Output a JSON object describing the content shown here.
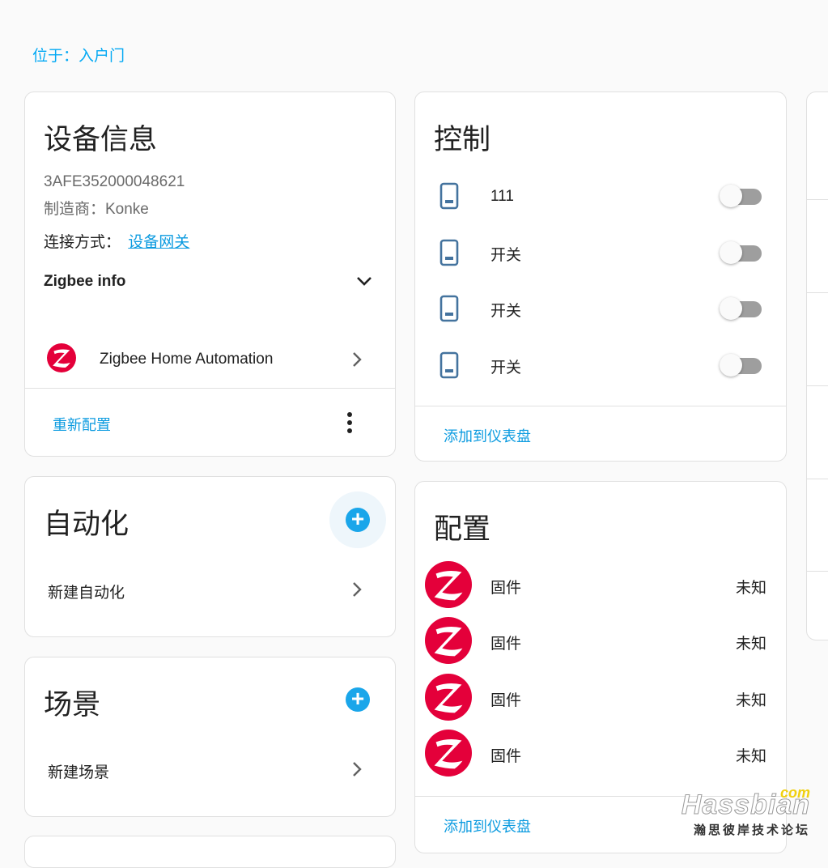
{
  "area": {
    "label": "位于：",
    "link": "入户门"
  },
  "device_info": {
    "title": "设备信息",
    "serial": "3AFE352000048621",
    "manufacturer": "制造商：Konke",
    "connection_label": "连接方式：",
    "connection_link": "设备网关",
    "zigbee_info_label": "Zigbee info",
    "integration": "Zigbee Home Automation",
    "reconfigure": "重新配置"
  },
  "automation": {
    "title": "自动化",
    "new_item": "新建自动化"
  },
  "scene": {
    "title": "场景",
    "new_item": "新建场景"
  },
  "controls": {
    "title": "控制",
    "items": [
      {
        "name": "111",
        "on": false
      },
      {
        "name": "开关",
        "on": false
      },
      {
        "name": "开关",
        "on": false
      },
      {
        "name": "开关",
        "on": false
      }
    ],
    "add_to_dashboard": "添加到仪表盘"
  },
  "config": {
    "title": "配置",
    "items": [
      {
        "name": "固件",
        "value": "未知"
      },
      {
        "name": "固件",
        "value": "未知"
      },
      {
        "name": "固件",
        "value": "未知"
      },
      {
        "name": "固件",
        "value": "未知"
      }
    ],
    "add_to_dashboard": "添加到仪表盘"
  },
  "watermark": {
    "com": "com",
    "main": "Hassbian",
    "sub": "瀚思彼岸技术论坛"
  },
  "colors": {
    "accent": "#03a9f4",
    "zigbee_red": "#e4003a",
    "toggle_off": "#9e9e9e"
  }
}
